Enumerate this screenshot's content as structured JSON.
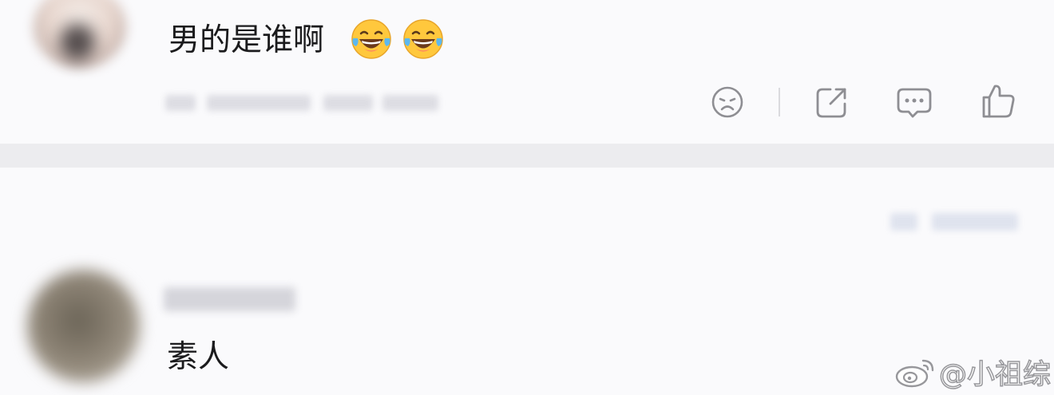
{
  "comments": [
    {
      "text": "男的是谁啊",
      "emojis": [
        "laughing-crying-emoji",
        "laughing-crying-emoji"
      ],
      "actions": [
        "dislike-icon",
        "share-icon",
        "reply-icon",
        "like-icon"
      ]
    },
    {
      "text": "素人"
    }
  ],
  "watermark": {
    "text": "@小祖综",
    "icon": "weibo-logo"
  },
  "colors": {
    "background": "#fafafc",
    "separator": "#ececef",
    "text": "#1b1b1d",
    "icon": "#8e8e93",
    "emoji_face": "#ffc83d"
  }
}
